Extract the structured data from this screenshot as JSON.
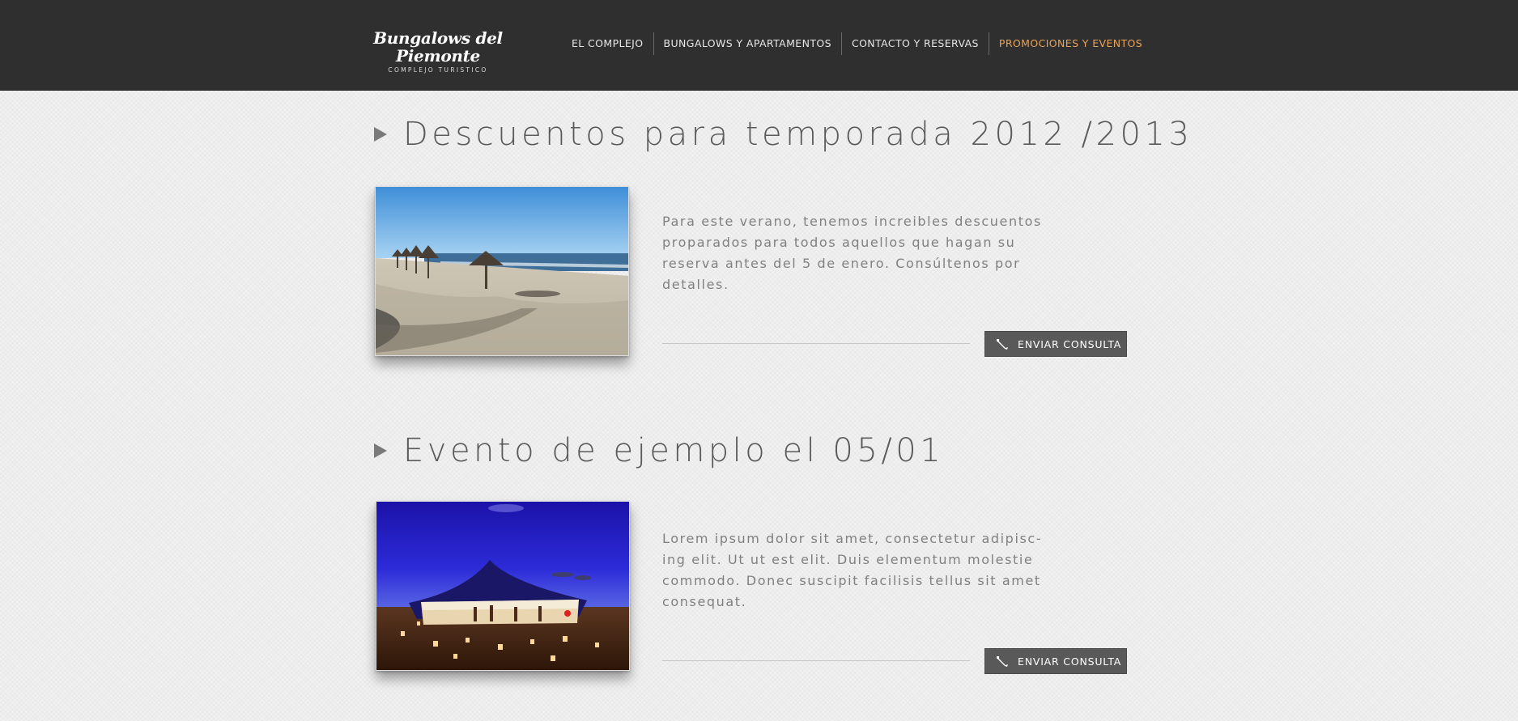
{
  "header": {
    "logo_title": "Bungalows del Piemonte",
    "logo_subtitle": "COMPLEJO TURISTICO",
    "nav": [
      {
        "label": "EL COMPLEJO"
      },
      {
        "label": "BUNGALOWS Y APARTAMENTOS"
      },
      {
        "label": "CONTACTO Y RESERVAS"
      },
      {
        "label": "PROMOCIONES Y EVENTOS",
        "active": true
      }
    ],
    "colors": {
      "background": "#2f2f2f",
      "active": "#e6a35b"
    }
  },
  "sections": [
    {
      "title": "Descuentos para temporada 2012 /2013",
      "image": "beach-umbrellas-photo",
      "description": "Para este verano, tenemos increibles descuentos proparados para todos aquellos que hagan su reserva antes del 5 de enero. Consúltenos por detalles.",
      "button_label": "ENVIAR CONSULTA",
      "button_icon": "pencil-icon"
    },
    {
      "title": "Evento de ejemplo el 05/01",
      "image": "night-tent-event-photo",
      "description": "Lorem ipsum dolor sit amet, consectetur adipisc-ing elit. Ut ut est elit. Duis elementum molestie commodo. Donec suscipit facilisis tellus sit amet consequat.",
      "button_label": "ENVIAR CONSULTA",
      "button_icon": "pencil-icon"
    }
  ]
}
